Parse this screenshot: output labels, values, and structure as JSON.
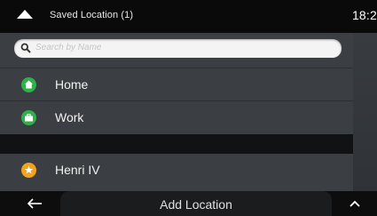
{
  "header": {
    "title": "Saved Location (1)",
    "clock": "18:2"
  },
  "search": {
    "placeholder": "Search by Name"
  },
  "locations": [
    {
      "label": "Home",
      "icon": "home-icon",
      "color": "#2db24a"
    },
    {
      "label": "Work",
      "icon": "briefcase-icon",
      "color": "#2db24a"
    },
    {
      "label": "Henri IV",
      "icon": "star-icon",
      "color": "#f2a31b"
    }
  ],
  "footer": {
    "add_label": "Add Location",
    "back_icon": "back-arrow-icon",
    "up_icon": "chevron-up-icon"
  }
}
